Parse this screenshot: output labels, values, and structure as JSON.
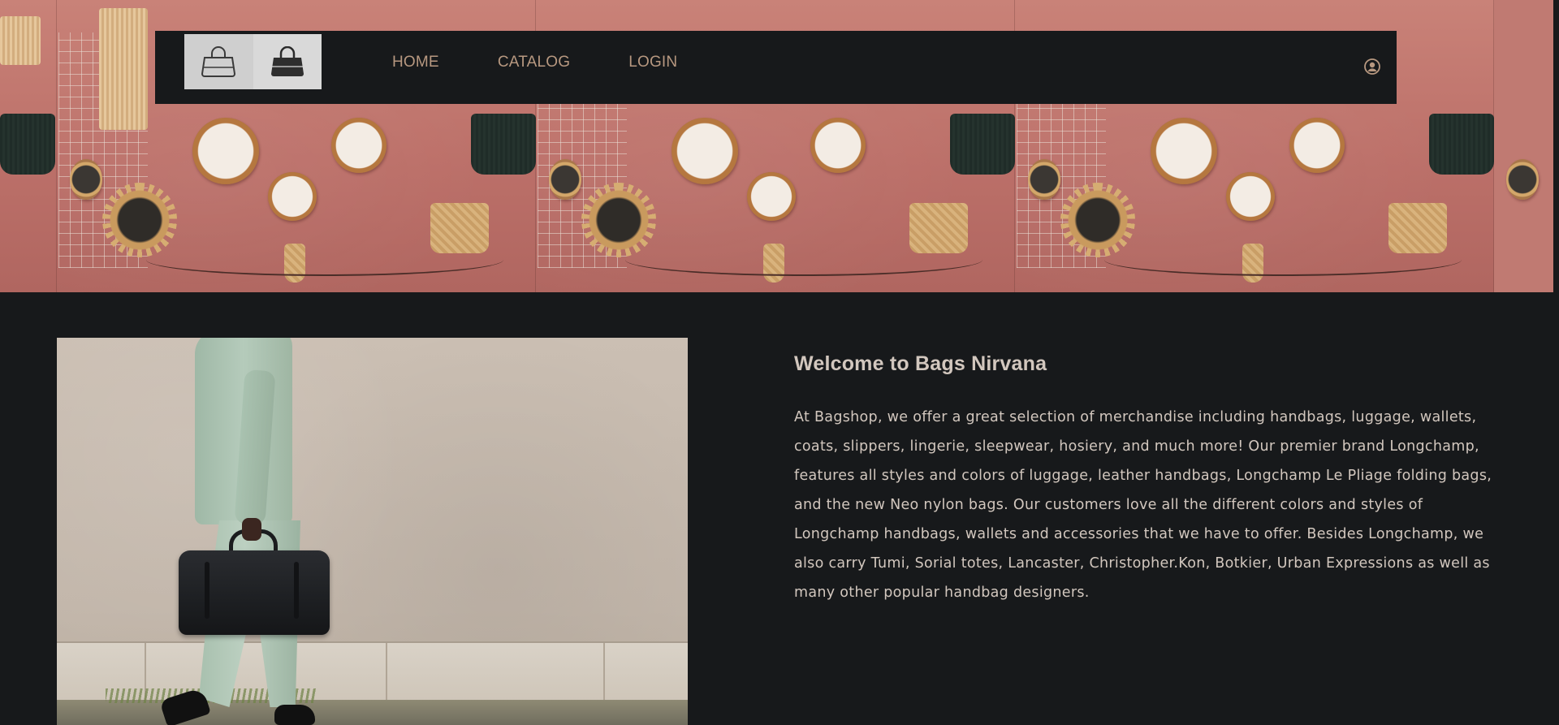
{
  "brand": {
    "logo_icon_left": "handbag-outline-icon",
    "logo_icon_right": "handbag-filled-icon"
  },
  "nav": {
    "items": [
      {
        "label": "HOME"
      },
      {
        "label": "CATALOG"
      },
      {
        "label": "LOGIN"
      }
    ],
    "user_icon": "user-circle-icon"
  },
  "hero": {
    "description_icon": "hanging-bags-and-mirrors-banner"
  },
  "main": {
    "title": "Welcome to Bags Nirvana",
    "body": "At Bagshop, we offer a great selection of merchandise including handbags, luggage, wallets, coats, slippers, lingerie, sleepwear, hosiery, and much more! Our premier brand Longchamp, features all styles and colors of luggage, leather handbags, Longchamp Le Pliage folding bags, and the new Neo nylon bags. Our customers love all the different colors and styles of Longchamp handbags, wallets and accessories that we have to offer. Besides Longchamp, we also carry Tumi, Sorial totes, Lancaster, Christopher.Kon, Botkier, Urban Expressions as well as many other popular handbag designers."
  },
  "colors": {
    "background": "#17191b",
    "nav_link": "#b79880",
    "text": "#d2c7be",
    "hero_wall": "#c07a72"
  }
}
